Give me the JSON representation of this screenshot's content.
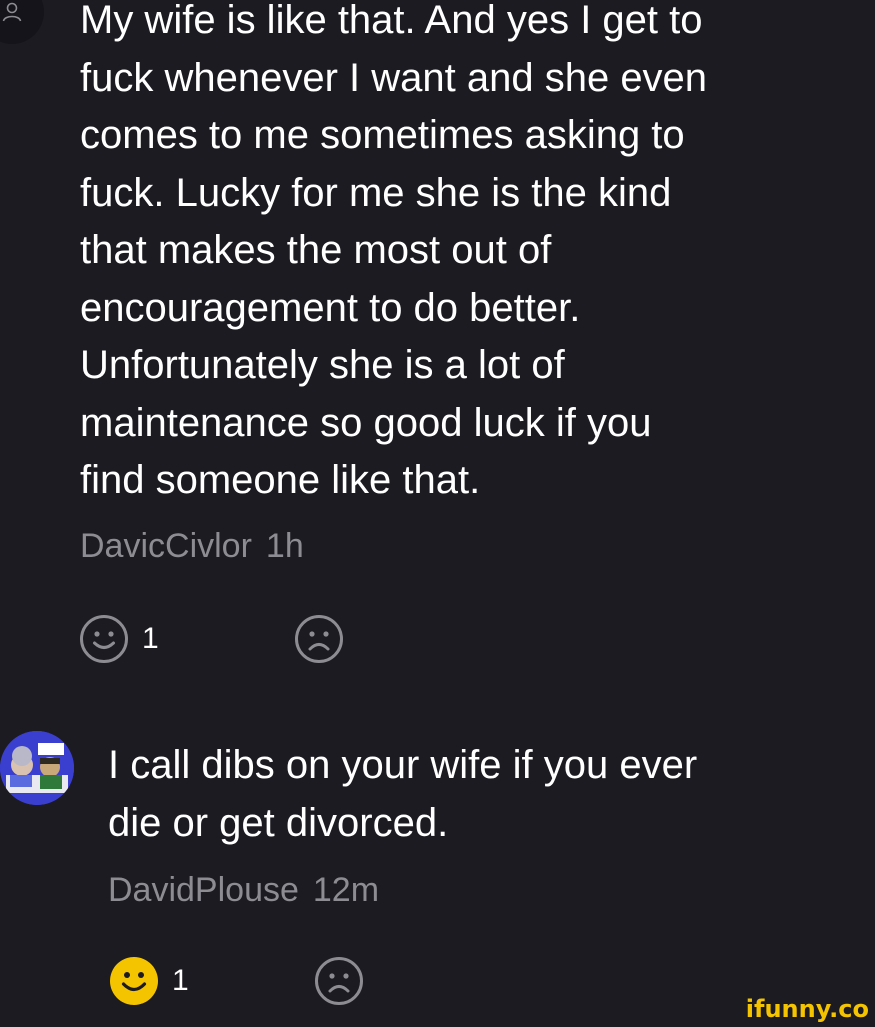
{
  "comments": [
    {
      "text": "My wife is like that. And yes I get to\nfuck whenever I want and she even\ncomes to me sometimes asking to\nfuck. Lucky for me she is the kind\nthat makes the most out of\nencouragement to do better.\nUnfortunately she is a lot of\nmaintenance so good luck if you\nfind someone like that.",
      "username": "DavicCivlor",
      "time": "1h",
      "smile_count": "1",
      "avatar_icon": "user-silhouette-icon",
      "smile_active": false
    },
    {
      "text": "I call dibs on your wife if you ever\ndie or get divorced.",
      "username": "DavidPlouse",
      "time": "12m",
      "smile_count": "1",
      "avatar_icon": "cartoon-avatar",
      "smile_active": true
    }
  ],
  "watermark": "ifunny.co",
  "colors": {
    "background": "#1c1b21",
    "text": "#ffffff",
    "meta": "#8d8c93",
    "active_smile": "#f5c400"
  }
}
